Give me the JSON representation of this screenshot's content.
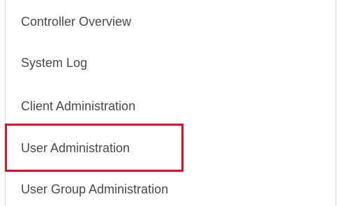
{
  "menu": {
    "items": [
      {
        "label": "Controller Overview"
      },
      {
        "label": "System Log"
      },
      {
        "label": "Client Administration"
      },
      {
        "label": "User Administration",
        "highlighted": true
      },
      {
        "label": "User Group Administration"
      }
    ]
  },
  "highlight": {
    "color": "#d2152a",
    "target": "User Administration"
  }
}
